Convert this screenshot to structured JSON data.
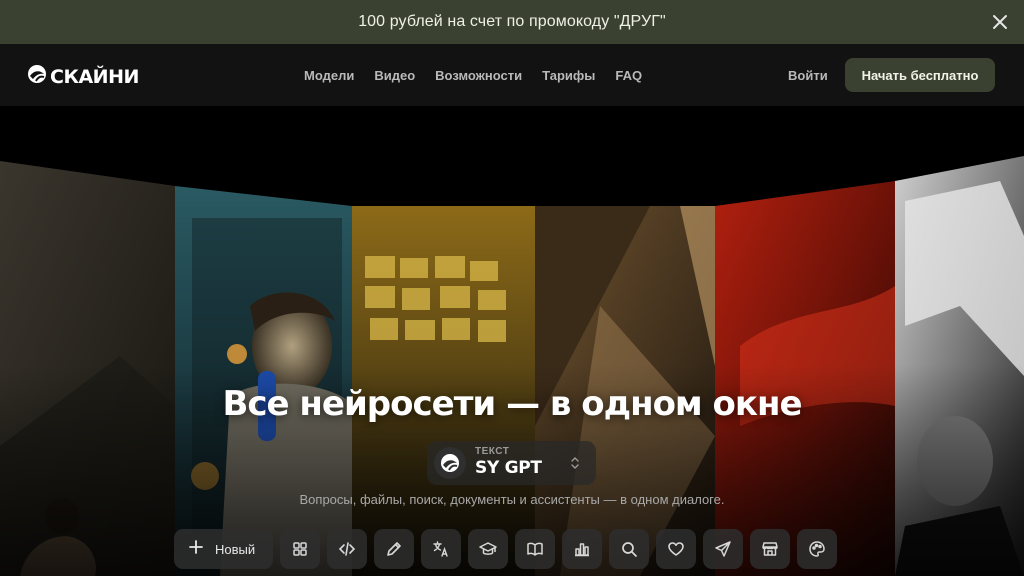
{
  "promo": {
    "text": "100 рублей на счет по промокоду \"ДРУГ\"",
    "close_icon": "close-icon"
  },
  "brand": {
    "name": "СКАЙНИ",
    "logo_icon": "skyeng-swoosh-icon"
  },
  "nav": {
    "items": [
      {
        "label": "Модели"
      },
      {
        "label": "Видео"
      },
      {
        "label": "Возможности"
      },
      {
        "label": "Тарифы"
      },
      {
        "label": "FAQ"
      }
    ]
  },
  "auth": {
    "login_label": "Войти",
    "start_label": "Начать бесплатно"
  },
  "hero": {
    "headline": "Все нейросети — в одном окне",
    "model": {
      "caption": "ТЕКСТ",
      "name": "SY GPT"
    },
    "subtitle": "Вопросы, файлы, поиск, документы и ассистенты — в одном диалоге."
  },
  "toolbar": {
    "new_label": "Новый",
    "tools": [
      "grid-icon",
      "code-icon",
      "pencil-icon",
      "translate-icon",
      "graduation-cap-icon",
      "book-icon",
      "bar-chart-icon",
      "search-icon",
      "heart-icon",
      "send-icon",
      "store-icon",
      "palette-icon"
    ]
  },
  "colors": {
    "accent": "#3b4130",
    "navbar": "#121212",
    "background": "#000000"
  }
}
